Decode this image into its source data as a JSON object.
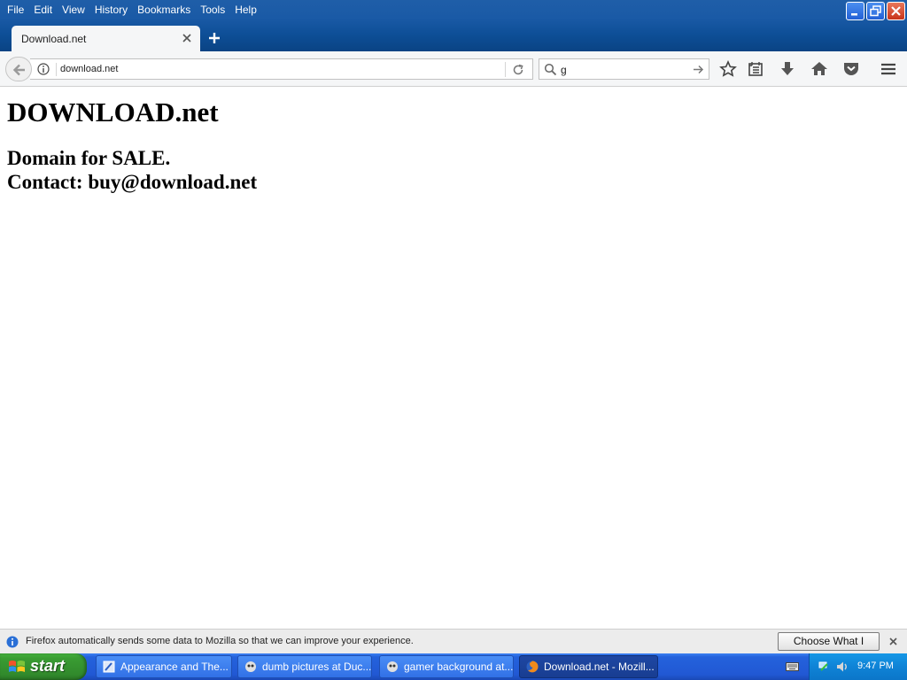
{
  "menu": [
    "File",
    "Edit",
    "View",
    "History",
    "Bookmarks",
    "Tools",
    "Help"
  ],
  "tab": {
    "title": "Download.net"
  },
  "nav": {
    "url": "download.net",
    "search_value": "g"
  },
  "page": {
    "heading": "DOWNLOAD.net",
    "line1": "Domain for SALE.",
    "line2": "Contact: buy@download.net"
  },
  "notification": {
    "text": "Firefox automatically sends some data to Mozilla so that we can improve your experience.",
    "button": "Choose What I Share"
  },
  "taskbar": {
    "start": "start",
    "tasks": [
      "Appearance and The...",
      "dumb pictures at Duc...",
      "gamer background at...",
      "Download.net - Mozill..."
    ],
    "clock": "9:47 PM"
  },
  "colors": {
    "frame_blue": "#1a5aa6",
    "taskbar_blue": "#2462dc",
    "start_green": "#3a9d33",
    "tray_blue": "#0f83d6"
  }
}
